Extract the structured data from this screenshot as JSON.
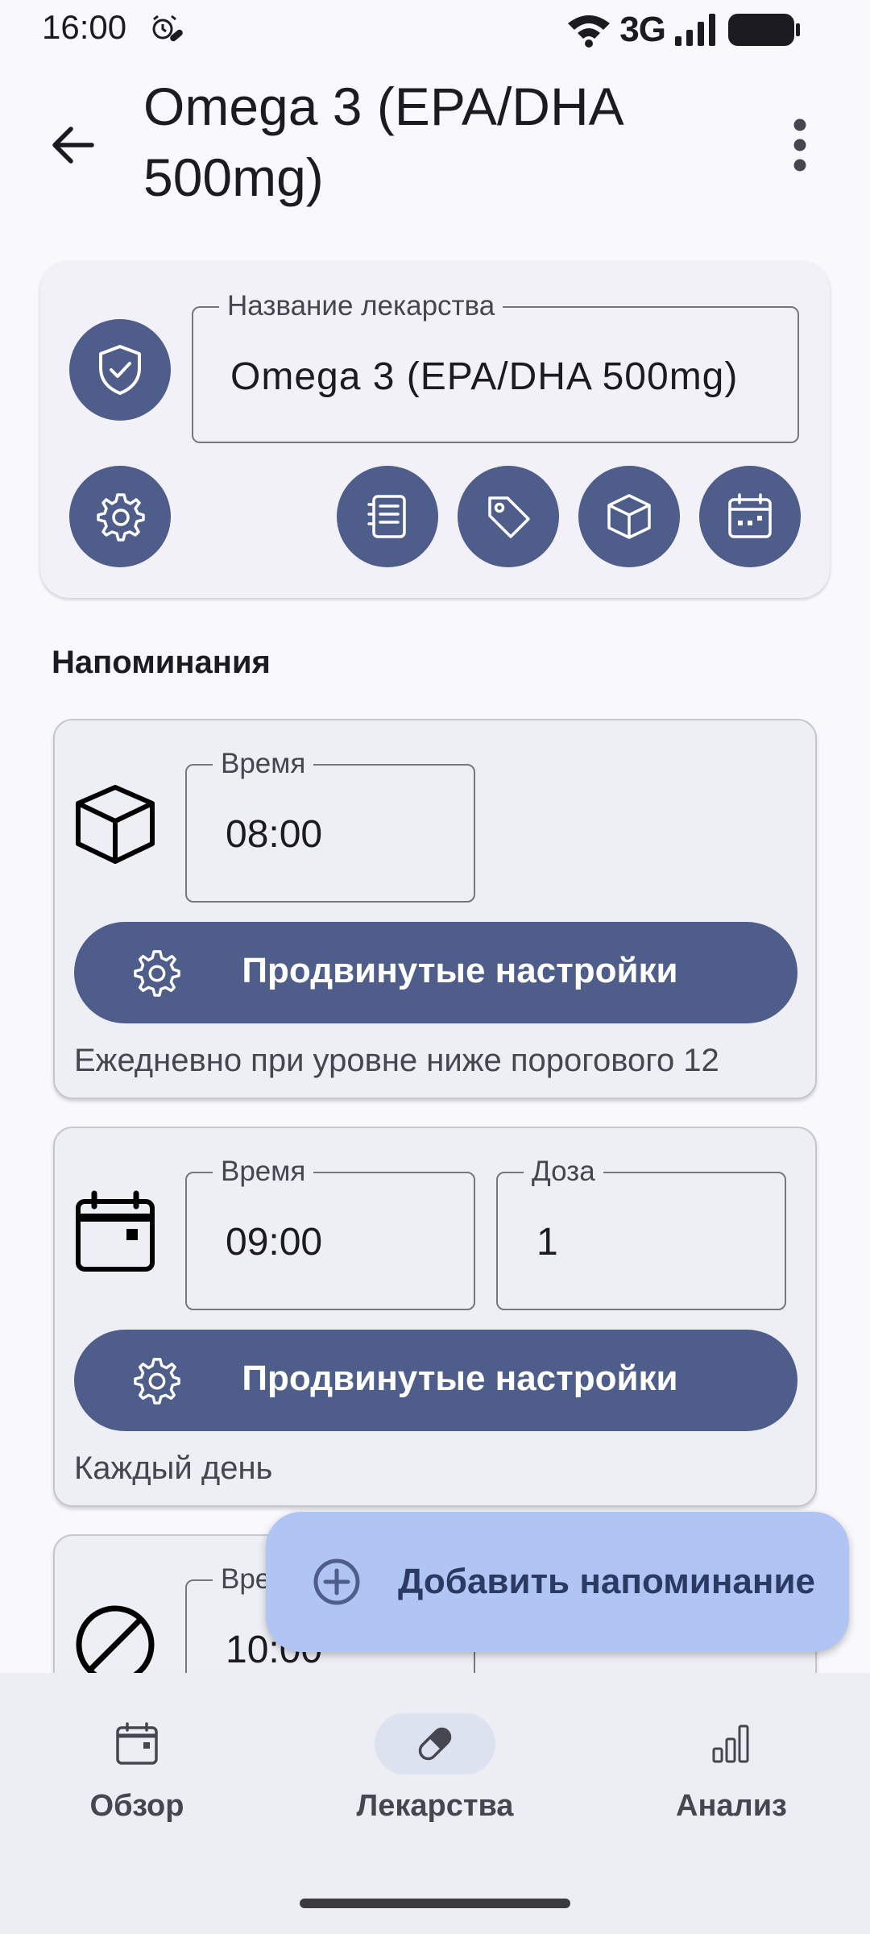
{
  "status_bar": {
    "time": "16:00",
    "network": "3G"
  },
  "header": {
    "title": "Omega 3 (EPA/DHA 500mg)"
  },
  "medication_card": {
    "name_label": "Название лекарства",
    "name_value": "Omega 3 (EPA/DHA 500mg)"
  },
  "reminders_section": {
    "title": "Напоминания"
  },
  "reminders": [
    {
      "type_icon": "box-icon",
      "time_label": "Время",
      "time_value": "08:00",
      "advanced_label": "Продвинутые настройки",
      "description": "Ежедневно при уровне ниже порогового 12"
    },
    {
      "type_icon": "calendar-icon",
      "time_label": "Время",
      "time_value": "09:00",
      "dose_label": "Доза",
      "dose_value": "1",
      "advanced_label": "Продвинутые настройки",
      "description": "Каждый день"
    },
    {
      "type_icon": "disabled-icon",
      "time_label": "Время",
      "time_value": "10:00"
    }
  ],
  "fab": {
    "label": "Добавить напоминание"
  },
  "bottom_nav": {
    "items": [
      {
        "label": "Обзор",
        "icon": "calendar-icon",
        "active": false
      },
      {
        "label": "Лекарства",
        "icon": "pill-icon",
        "active": true
      },
      {
        "label": "Анализ",
        "icon": "bar-chart-icon",
        "active": false
      }
    ]
  },
  "colors": {
    "primary": "#4f5d8a",
    "fab_container": "#b1c5f5",
    "background": "#f9f9fd",
    "card_surface": "#f1f1f7"
  }
}
